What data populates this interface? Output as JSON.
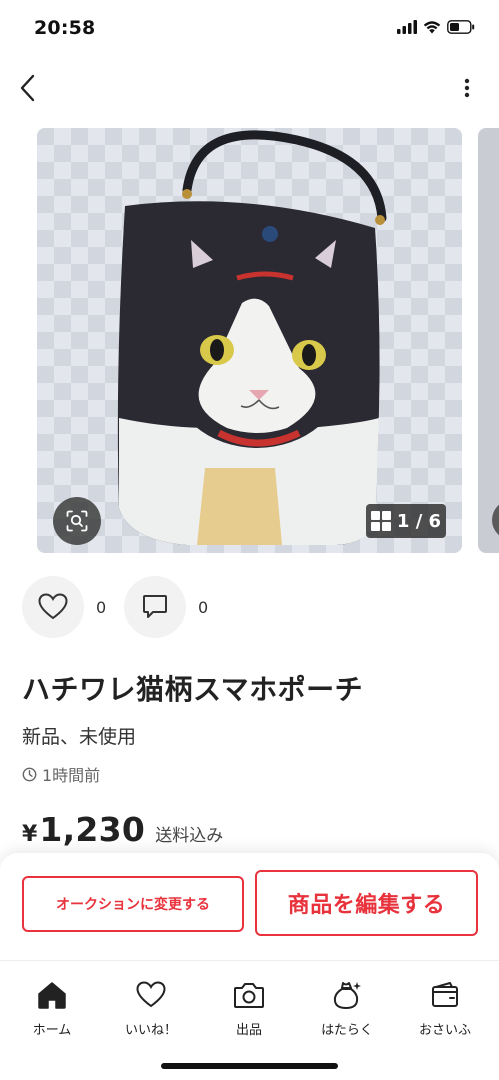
{
  "status_bar": {
    "time": "20:58"
  },
  "nav": {
    "back_icon": "chevron-left-icon",
    "more_icon": "more-vertical-icon"
  },
  "gallery": {
    "page_indicator": "1 / 6",
    "zoom_icon": "image-search-icon",
    "grid_icon": "grid-icon"
  },
  "reactions": {
    "like_count": "0",
    "comment_count": "0"
  },
  "item": {
    "title": "ハチワレ猫柄スマホポーチ",
    "condition": "新品、未使用",
    "posted": "1時間前",
    "price_currency": "¥",
    "price": "1,230",
    "shipping": "送料込み"
  },
  "buttons": {
    "auction": "オークションに変更する",
    "edit": "商品を編集する"
  },
  "tabs": [
    {
      "label": "ホーム",
      "icon": "home-icon"
    },
    {
      "label": "いいね！",
      "icon": "heart-icon"
    },
    {
      "label": "出品",
      "icon": "camera-icon"
    },
    {
      "label": "はたらく",
      "icon": "money-bag-icon"
    },
    {
      "label": "おさいふ",
      "icon": "wallet-icon"
    }
  ],
  "colors": {
    "accent": "#e8323c",
    "text": "#222222"
  }
}
